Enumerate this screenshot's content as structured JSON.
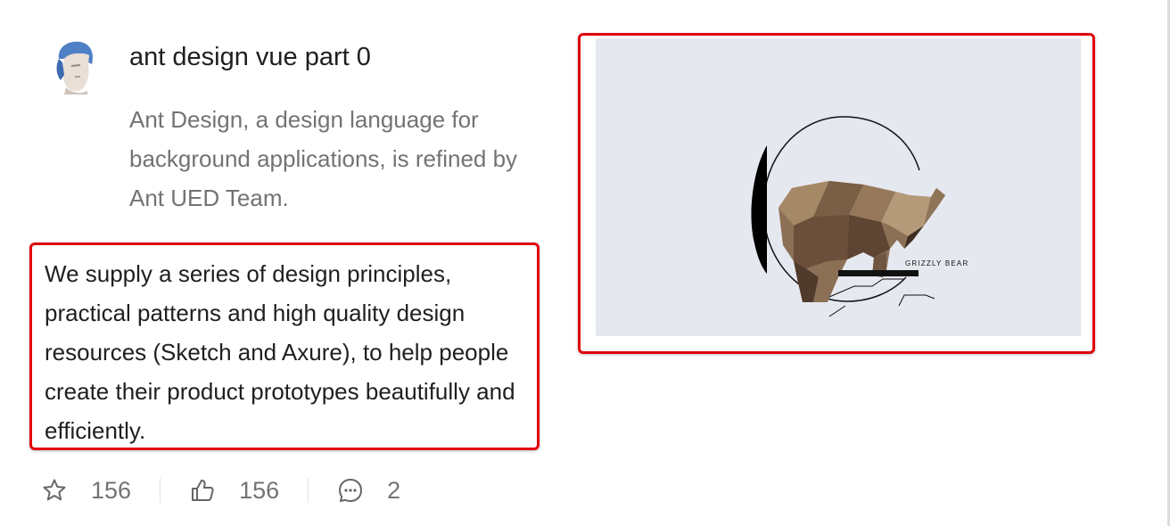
{
  "article": {
    "title": "ant design vue part 0",
    "description": "Ant Design, a design language for background applications, is refined by Ant UED Team.",
    "content": "We supply a series of design principles, practical patterns and high quality design resources (Sketch and Axure), to help people create their product prototypes beautifully and efficiently.",
    "cover_caption": "GRIZZLY BEAR",
    "avatar_icon": "user-avatar"
  },
  "actions": [
    {
      "icon": "star-icon",
      "count": "156"
    },
    {
      "icon": "like-icon",
      "count": "156"
    },
    {
      "icon": "message-icon",
      "count": "2"
    }
  ],
  "colors": {
    "highlight_border": "#e0000a",
    "cover_background": "#e6e8ef",
    "muted_text": "#737373"
  }
}
